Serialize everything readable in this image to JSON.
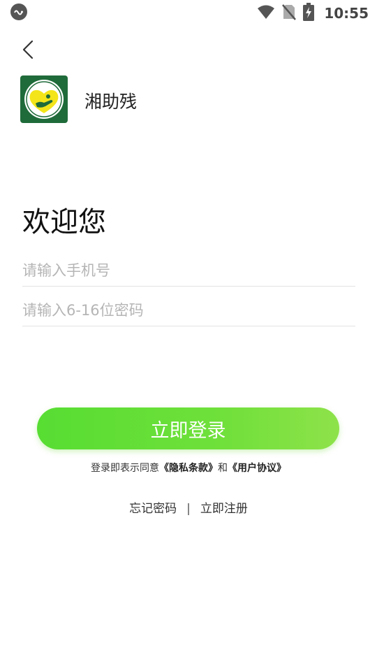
{
  "status_bar": {
    "time": "10:55",
    "icons": [
      "app-indicator-icon",
      "wifi-icon",
      "no-sim-icon",
      "battery-charging-icon"
    ]
  },
  "app": {
    "name": "湘助残",
    "logo_text": "湘助残"
  },
  "login": {
    "welcome": "欢迎您",
    "phone_placeholder": "请输入手机号",
    "phone_value": "",
    "password_placeholder": "请输入6-16位密码",
    "password_value": "",
    "login_button": "立即登录",
    "agreement_prefix": "登录即表示同意",
    "privacy_link": "《隐私条款》",
    "agreement_and": "和",
    "terms_link": "《用户协议》",
    "forgot_password": "忘记密码",
    "separator": "|",
    "register": "立即注册"
  },
  "colors": {
    "accent_start": "#57dd33",
    "accent_end": "#8ee24a",
    "logo_bg": "#1f6b3a",
    "logo_heart": "#f3e51a",
    "placeholder": "#b5b5b5"
  }
}
